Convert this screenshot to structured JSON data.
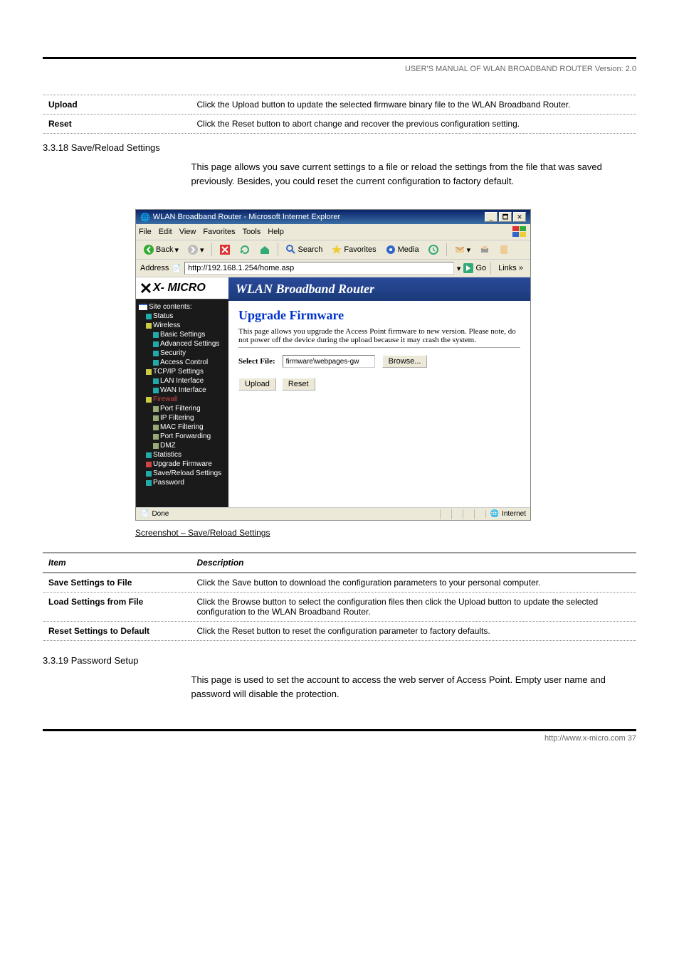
{
  "header": {
    "text": "USER'S MANUAL OF WLAN BROADBAND ROUTER                                                                Version: 2.0"
  },
  "intro_table": {
    "row1_label": "Upload",
    "row1_desc": "Click the Upload button to update the selected firmware binary file to the WLAN Broadband Router.",
    "row2_label": "Reset",
    "row2_desc": "Click the Reset button to abort change and recover the previous configuration setting."
  },
  "section": {
    "number": "3.3.18 Save/Reload Settings"
  },
  "section_body": "This page allows you save current settings to a file or reload the settings from the file that was saved previously. Besides, you could reset the current configuration to factory default.",
  "ie": {
    "title": "WLAN Broadband Router - Microsoft Internet Explorer",
    "menu": {
      "file": "File",
      "edit": "Edit",
      "view": "View",
      "favorites": "Favorites",
      "tools": "Tools",
      "help": "Help"
    },
    "toolbar": {
      "back": "Back",
      "search": "Search",
      "favorites": "Favorites",
      "media": "Media"
    },
    "address_label": "Address",
    "address_url": "http://192.168.1.254/home.asp",
    "go": "Go",
    "links": "Links",
    "logo": "X- MICRO",
    "header_band": "WLAN Broadband Router",
    "tree": {
      "root": "Site contents:",
      "status": "Status",
      "wireless": "Wireless",
      "basic": "Basic Settings",
      "advanced": "Advanced Settings",
      "security": "Security",
      "access": "Access Control",
      "tcpip": "TCP/IP Settings",
      "lan": "LAN Interface",
      "wan": "WAN Interface",
      "firewall": "Firewall",
      "portfilter": "Port Filtering",
      "ipfilter": "IP Filtering",
      "macfilter": "MAC Filtering",
      "portfwd": "Port Forwarding",
      "dmz": "DMZ",
      "stats": "Statistics",
      "upgrade": "Upgrade Firmware",
      "savereload": "Save/Reload Settings",
      "password": "Password"
    },
    "main": {
      "heading": "Upgrade Firmware",
      "desc": "This page allows you upgrade the Access Point firmware to new version. Please note, do not power off the device during the upload because it may crash the system.",
      "select_label": "Select File:",
      "file_value": "firmware\\webpages-gw",
      "browse": "Browse...",
      "upload": "Upload",
      "reset": "Reset"
    },
    "status": {
      "done": "Done",
      "zone": "Internet"
    }
  },
  "caption": "Screenshot – Save/Reload Settings",
  "lower_table": {
    "hdr_item": "Item",
    "hdr_desc": "Description",
    "r1_label": "Save Settings to File",
    "r1_desc": "Click the Save button to download the configuration parameters to your personal computer.",
    "r2_label": "Load Settings from File",
    "r2_desc": "Click the Browse button to select the configuration files then click the Upload button to update the selected configuration to the WLAN Broadband Router.",
    "r3_label": "Reset Settings to Default",
    "r3_desc": "Click the Reset button to reset the configuration parameter to factory defaults."
  },
  "section2": {
    "number": "3.3.19 Password Setup"
  },
  "section2_body": "This page is used to set the account to access the web server of Access Point. Empty user name and password will disable the protection.",
  "footer": "http://www.x-micro.com                                                                                                                                                                  37"
}
